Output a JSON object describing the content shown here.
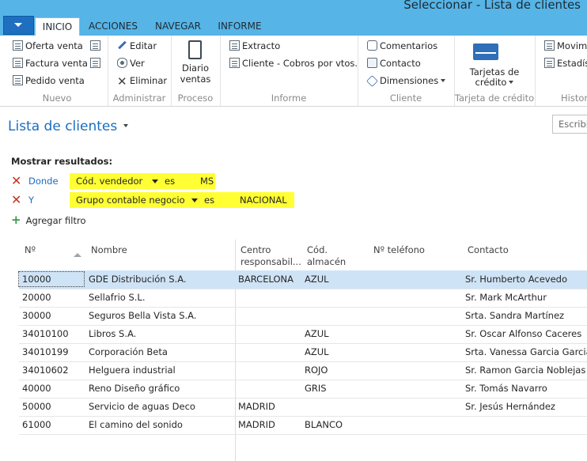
{
  "window": {
    "title": "Seleccionar - Lista de clientes"
  },
  "tabs": [
    {
      "label": "INICIO",
      "active": true
    },
    {
      "label": "ACCIONES",
      "active": false
    },
    {
      "label": "NAVEGAR",
      "active": false
    },
    {
      "label": "INFORME",
      "active": false
    }
  ],
  "ribbon": {
    "nuevo": {
      "label": "Nuevo",
      "items": [
        "Oferta venta",
        "Factura venta",
        "Pedido venta"
      ]
    },
    "administrar": {
      "label": "Administrar",
      "items": [
        "Editar",
        "Ver",
        "Eliminar"
      ]
    },
    "proceso": {
      "label": "Proceso",
      "big_line1": "Diario",
      "big_line2": "ventas"
    },
    "informe": {
      "label": "Informe",
      "items": [
        "Extracto",
        "Cliente - Cobros por vtos."
      ]
    },
    "cliente": {
      "label": "Cliente",
      "items": [
        "Comentarios",
        "Contacto",
        "Dimensiones"
      ]
    },
    "tarjeta": {
      "label": "Tarjeta de crédito",
      "big_line1": "Tarjetas de",
      "big_line2": "crédito"
    },
    "historial": {
      "label": "Histor",
      "items": [
        "Movim",
        "Estadís"
      ]
    }
  },
  "page": {
    "title": "Lista de clientes",
    "search_placeholder": "Escribi"
  },
  "filters": {
    "heading": "Mostrar resultados:",
    "rows": [
      {
        "keyword": "Donde",
        "field": "Cód. vendedor",
        "operator": "es",
        "value": "MS"
      },
      {
        "keyword": "Y",
        "field": "Grupo contable negocio",
        "operator": "es",
        "value": "NACIONAL"
      }
    ],
    "add_label": "Agregar filtro"
  },
  "table": {
    "headers": {
      "no": "Nº",
      "nombre": "Nombre",
      "centro_l1": "Centro",
      "centro_l2": "responsabil...",
      "almacen_l1": "Cód.",
      "almacen_l2": "almacén",
      "telefono": "Nº teléfono",
      "contacto": "Contacto"
    },
    "rows": [
      {
        "no": "10000",
        "nombre": "GDE Distribución S.A.",
        "centro": "BARCELONA",
        "almacen": "AZUL",
        "telefono": "",
        "contacto": "Sr. Humberto Acevedo"
      },
      {
        "no": "20000",
        "nombre": "Sellafrio S.L.",
        "centro": "",
        "almacen": "",
        "telefono": "",
        "contacto": "Sr. Mark McArthur"
      },
      {
        "no": "30000",
        "nombre": "Seguros Bella Vista S.A.",
        "centro": "",
        "almacen": "",
        "telefono": "",
        "contacto": "Srta. Sandra Martínez"
      },
      {
        "no": "34010100",
        "nombre": "Libros S.A.",
        "centro": "",
        "almacen": "AZUL",
        "telefono": "",
        "contacto": "Sr. Oscar Alfonso Caceres"
      },
      {
        "no": "34010199",
        "nombre": "Corporación Beta",
        "centro": "",
        "almacen": "AZUL",
        "telefono": "",
        "contacto": "Srta. Vanessa Garcia Garcia"
      },
      {
        "no": "34010602",
        "nombre": "Helguera industrial",
        "centro": "",
        "almacen": "ROJO",
        "telefono": "",
        "contacto": "Sr. Ramon Garcia Noblejas"
      },
      {
        "no": "40000",
        "nombre": "Reno Diseño gráfico",
        "centro": "",
        "almacen": "GRIS",
        "telefono": "",
        "contacto": "Sr. Tomás Navarro"
      },
      {
        "no": "50000",
        "nombre": "Servicio de aguas Deco",
        "centro": "MADRID",
        "almacen": "",
        "telefono": "",
        "contacto": "Sr. Jesús Hernández"
      },
      {
        "no": "61000",
        "nombre": "El camino del sonido",
        "centro": "MADRID",
        "almacen": "BLANCO",
        "telefono": "",
        "contacto": ""
      }
    ]
  },
  "colors": {
    "titlebar": "#56b4e6",
    "accent": "#1a6dc2",
    "highlight": "#ffff33",
    "selected_row": "#cfe3f6"
  }
}
